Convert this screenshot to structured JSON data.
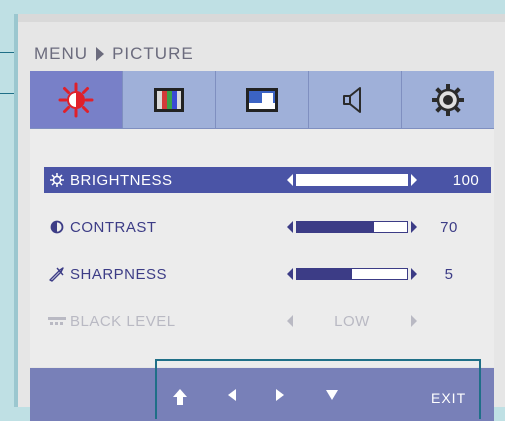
{
  "breadcrumb": {
    "menu": "MENU",
    "section": "PICTURE"
  },
  "tabs": [
    {
      "icon": "brightness-sun-icon",
      "active": true
    },
    {
      "icon": "color-bars-icon",
      "active": false
    },
    {
      "icon": "display-screen-icon",
      "active": false
    },
    {
      "icon": "speaker-icon",
      "active": false
    },
    {
      "icon": "gear-icon",
      "active": false
    }
  ],
  "settings": [
    {
      "icon": "sun-icon",
      "label": "BRIGHTNESS",
      "value": "100",
      "level": 100,
      "selected": true,
      "disabled": false
    },
    {
      "icon": "contrast-icon",
      "label": "CONTRAST",
      "value": "70",
      "level": 70,
      "selected": false,
      "disabled": false
    },
    {
      "icon": "sharpness-icon",
      "label": "SHARPNESS",
      "value": "5",
      "level": 50,
      "selected": false,
      "disabled": false
    },
    {
      "icon": "black-level-icon",
      "label": "BLACK LEVEL",
      "value": "LOW",
      "selected": false,
      "disabled": true
    }
  ],
  "footer": {
    "exit_label": "EXIT"
  },
  "colors": {
    "accent": "#4a54a6",
    "tab_bg": "#9fb0d9",
    "tab_active": "#7880c8",
    "text": "#3c3c86",
    "disabled": "#b9b9c3"
  }
}
